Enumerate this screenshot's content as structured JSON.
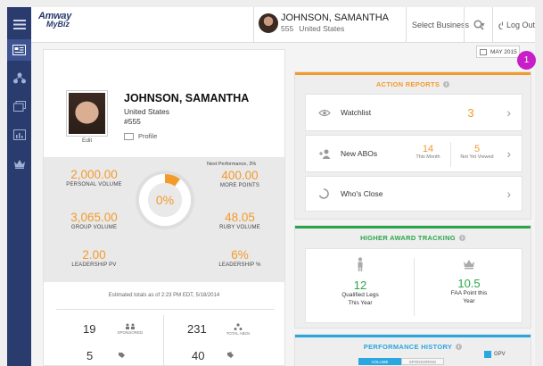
{
  "header": {
    "logo_brand": "Amway",
    "logo_sub": "MyBiz",
    "user_name": "JOHNSON, SAMANTHA",
    "user_id": "555",
    "user_country": "United States",
    "select_business": "Select Business",
    "logout": "Log Out"
  },
  "date_selector": "MAY 2015",
  "marker": "1",
  "profile": {
    "name": "JOHNSON, SAMANTHA",
    "country": "United States",
    "id": "#555",
    "edit": "Edit",
    "profile_link": "Profile"
  },
  "stats": {
    "personal_volume": "2,000.00",
    "personal_volume_label": "PERSONAL VOLUME",
    "performance_pct": "0%",
    "performance_progress": 0.1,
    "next_performance": "Next Performance, 3%",
    "more_points": "400.00",
    "more_points_label": "MORE POINTS",
    "group_volume": "3,065.00",
    "group_volume_label": "GROUP VOLUME",
    "ruby_volume": "48.05",
    "ruby_volume_label": "RUBY VOLUME",
    "leadership_pv": "2.00",
    "leadership_pv_label": "LEADERSHIP PV",
    "leadership_pct": "6%",
    "leadership_pct_label": "LEADERSHIP %"
  },
  "estimate_text": "Estimated totals as of 2:23 PM EDT, 5/18/2014",
  "bottom": {
    "sponsored": "19",
    "sponsored_label": "SPONSORED",
    "total_abos": "231",
    "total_abos_label": "TOTAL ABOs",
    "item3": "5",
    "item4": "40"
  },
  "action_reports": {
    "title": "ACTION REPORTS",
    "watchlist_label": "Watchlist",
    "watchlist_count": "3",
    "new_abos_label": "New ABOs",
    "this_month": "14",
    "this_month_label": "This Month",
    "not_viewed": "5",
    "not_viewed_label": "Not Yet Viewed",
    "whos_close_label": "Who's Close"
  },
  "higher_award": {
    "title": "HIGHER AWARD TRACKING",
    "qualified_legs": "12",
    "qualified_legs_label_1": "Qualified Legs",
    "qualified_legs_label_2": "This Year",
    "faa_points": "10.5",
    "faa_points_label_1": "FAA Point this",
    "faa_points_label_2": "Year"
  },
  "performance_history": {
    "title": "PERFORMANCE HISTORY",
    "tab_1": "VOLUME",
    "tab_2": "SPONSORING",
    "legend": "GPV"
  },
  "colors": {
    "sidebar": "#2a3b6d",
    "orange": "#f39a2b",
    "green": "#2aa64a",
    "blue": "#2aa6e0",
    "marker": "#c81ec8"
  }
}
